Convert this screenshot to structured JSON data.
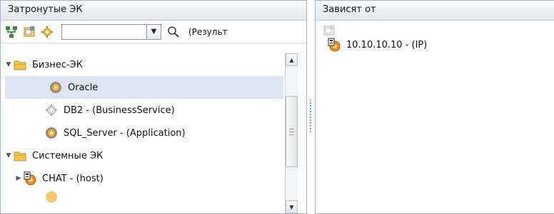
{
  "left_panel": {
    "title": "Затронутые ЭК",
    "toolbar": {
      "icons": [
        "topology-icon",
        "properties-icon",
        "gear-icon"
      ],
      "search_value": "",
      "search_icon": "magnifier-icon",
      "result_label": "(Результ"
    },
    "tree": [
      {
        "label": "Бизнес-ЭК",
        "type": "folder",
        "expanded": true,
        "level": 0
      },
      {
        "label": "Oracle",
        "type": "service",
        "level": 1,
        "selected": true
      },
      {
        "label": "DB2 - (BusinessService)",
        "type": "service-grey",
        "level": 1
      },
      {
        "label": "SQL_Server - (Application)",
        "type": "service",
        "level": 1
      },
      {
        "label": "Системные ЭК",
        "type": "folder",
        "expanded": true,
        "level": 0
      },
      {
        "label": "CHAT - (host)",
        "type": "host",
        "level": 1,
        "collapsed": true
      }
    ]
  },
  "right_panel": {
    "title": "Зависят от",
    "toolbar_icon": "properties-icon-disabled",
    "items": [
      {
        "label": "10.10.10.10 - (IP)",
        "icon": "ip-node-icon"
      }
    ]
  },
  "colors": {
    "selection": "#dde5f0",
    "header_bg": "#e3e8ee",
    "folder": "#f3c64a"
  }
}
